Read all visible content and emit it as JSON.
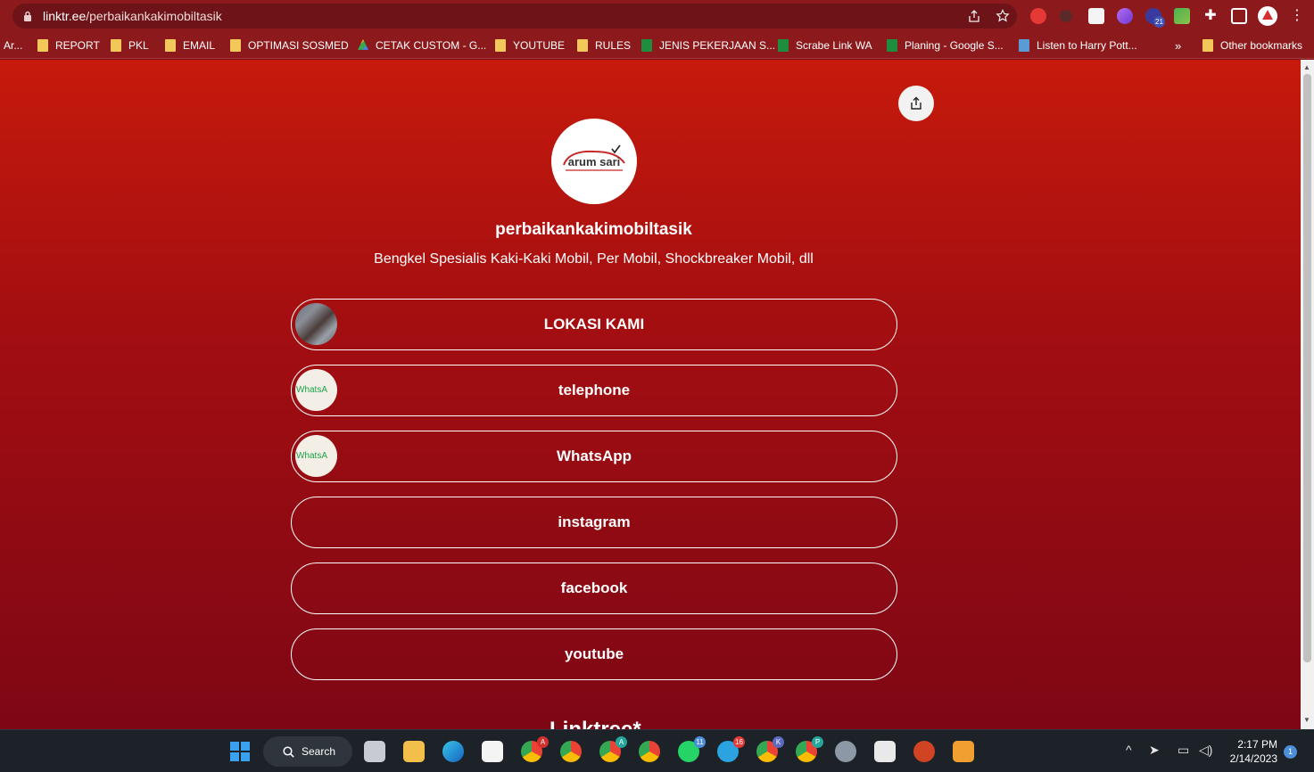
{
  "browser": {
    "url_host": "linktr.ee",
    "url_path": "/perbaikankakimobiltasik",
    "ext_badge": "21",
    "bookmarks": [
      {
        "label": "Ar...",
        "icon": "overflow-icon"
      },
      {
        "label": "REPORT",
        "icon": "folder-icon"
      },
      {
        "label": "PKL",
        "icon": "folder-icon"
      },
      {
        "label": "EMAIL",
        "icon": "folder-icon"
      },
      {
        "label": "OPTIMASI SOSMED",
        "icon": "folder-icon"
      },
      {
        "label": "CETAK CUSTOM - G...",
        "icon": "drive-icon"
      },
      {
        "label": "YOUTUBE",
        "icon": "folder-icon"
      },
      {
        "label": "RULES",
        "icon": "folder-icon"
      },
      {
        "label": "JENIS PEKERJAAN S...",
        "icon": "sheets-icon"
      },
      {
        "label": "Scrabe Link WA",
        "icon": "sheets-icon"
      },
      {
        "label": "Planing - Google S...",
        "icon": "sheets-icon"
      },
      {
        "label": "Listen to Harry Pott...",
        "icon": "m-icon"
      }
    ],
    "more_chevron": "»",
    "other_bookmarks": "Other bookmarks"
  },
  "profile": {
    "logo_text": "arum sari",
    "name": "perbaikankakimobiltasik",
    "bio": "Bengkel Spesialis Kaki-Kaki Mobil, Per Mobil, Shockbreaker Mobil, dll"
  },
  "links": [
    {
      "label": "LOKASI KAMI",
      "thumb": "photo"
    },
    {
      "label": "telephone",
      "thumb": "whatsapp",
      "thumb_text": "WhatsA"
    },
    {
      "label": "WhatsApp",
      "thumb": "whatsapp",
      "thumb_text": "WhatsA"
    },
    {
      "label": "instagram",
      "thumb": "none"
    },
    {
      "label": "facebook",
      "thumb": "none"
    },
    {
      "label": "youtube",
      "thumb": "none"
    }
  ],
  "footer": {
    "brand": "Linktree*"
  },
  "taskbar": {
    "search_label": "Search",
    "badges": {
      "whatsapp": "11",
      "telegram": "16",
      "chrome_k": "K",
      "chrome_p": "P",
      "chrome_a": "A"
    },
    "time": "2:17 PM",
    "date": "2/14/2023",
    "notifications": "1"
  },
  "colors": {
    "page_gradient_top": "#c61a0c",
    "page_gradient_bottom": "#7e0715",
    "browser_chrome": "#8c1a1d"
  }
}
